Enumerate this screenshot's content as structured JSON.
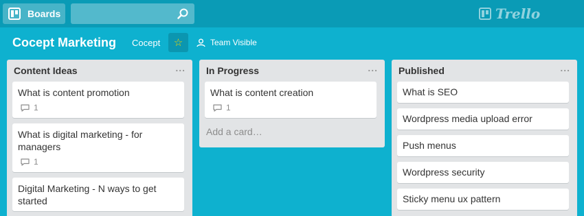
{
  "topbar": {
    "boards_label": "Boards",
    "search_placeholder": "",
    "logo_text": "Trello"
  },
  "board": {
    "title": "Cocept Marketing",
    "org": "Cocept",
    "visibility": "Team Visible",
    "star_glyph": "☆"
  },
  "lists": [
    {
      "title": "Content Ideas",
      "menu": "...",
      "cards": [
        {
          "title": "What is content promotion",
          "comments": "1"
        },
        {
          "title": "What is digital marketing - for managers",
          "comments": "1"
        },
        {
          "title": "Digital Marketing - N ways to get started"
        }
      ]
    },
    {
      "title": "In Progress",
      "menu": "...",
      "cards": [
        {
          "title": "What is content creation",
          "comments": "1"
        }
      ],
      "add_card": "Add a card…"
    },
    {
      "title": "Published",
      "menu": "...",
      "cards": [
        {
          "title": "What is SEO"
        },
        {
          "title": "Wordpress media upload error"
        },
        {
          "title": "Push menus"
        },
        {
          "title": "Wordpress security"
        },
        {
          "title": "Sticky menu ux pattern"
        }
      ]
    }
  ],
  "colors": {
    "background": "#0eb1cf",
    "topbar": "#0a9bb6",
    "list": "#e2e4e6",
    "star": "#f2d600"
  }
}
